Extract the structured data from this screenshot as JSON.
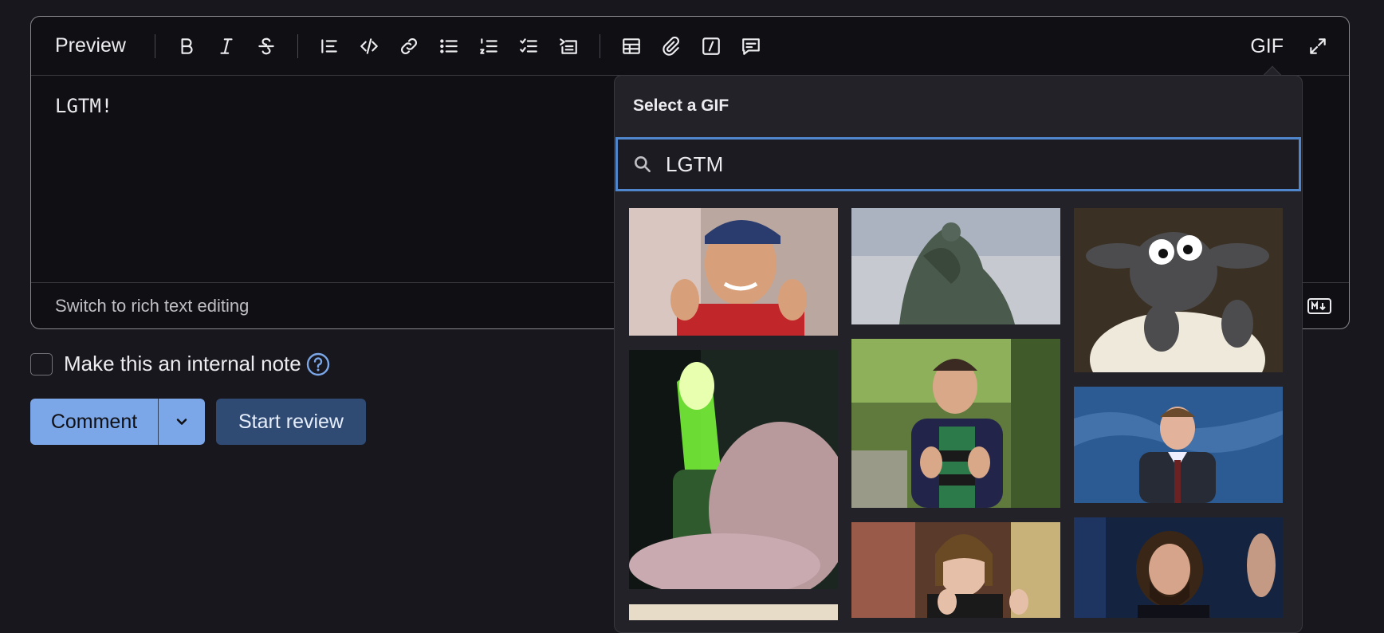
{
  "toolbar": {
    "preview_label": "Preview",
    "gif_label": "GIF",
    "icons": [
      "bold-icon",
      "italic-icon",
      "strikethrough-icon",
      "blockquote-icon",
      "code-icon",
      "link-icon",
      "bullet-list-icon",
      "numbered-list-icon",
      "task-list-icon",
      "collapsible-icon",
      "table-icon",
      "attachment-icon",
      "quick-action-icon",
      "comment-template-icon",
      "fullscreen-icon"
    ]
  },
  "editor": {
    "content": "LGTM!",
    "switch_label": "Switch to rich text editing"
  },
  "note": {
    "label": "Make this an internal note",
    "checked": false
  },
  "actions": {
    "comment_label": "Comment",
    "review_label": "Start review"
  },
  "gif_picker": {
    "title": "Select a GIF",
    "search_value": "LGTM",
    "accent_color": "#4f86cc"
  },
  "colors": {
    "primary_button": "#7ba7e8",
    "secondary_button": "#2f4a73",
    "background": "#18171d"
  }
}
